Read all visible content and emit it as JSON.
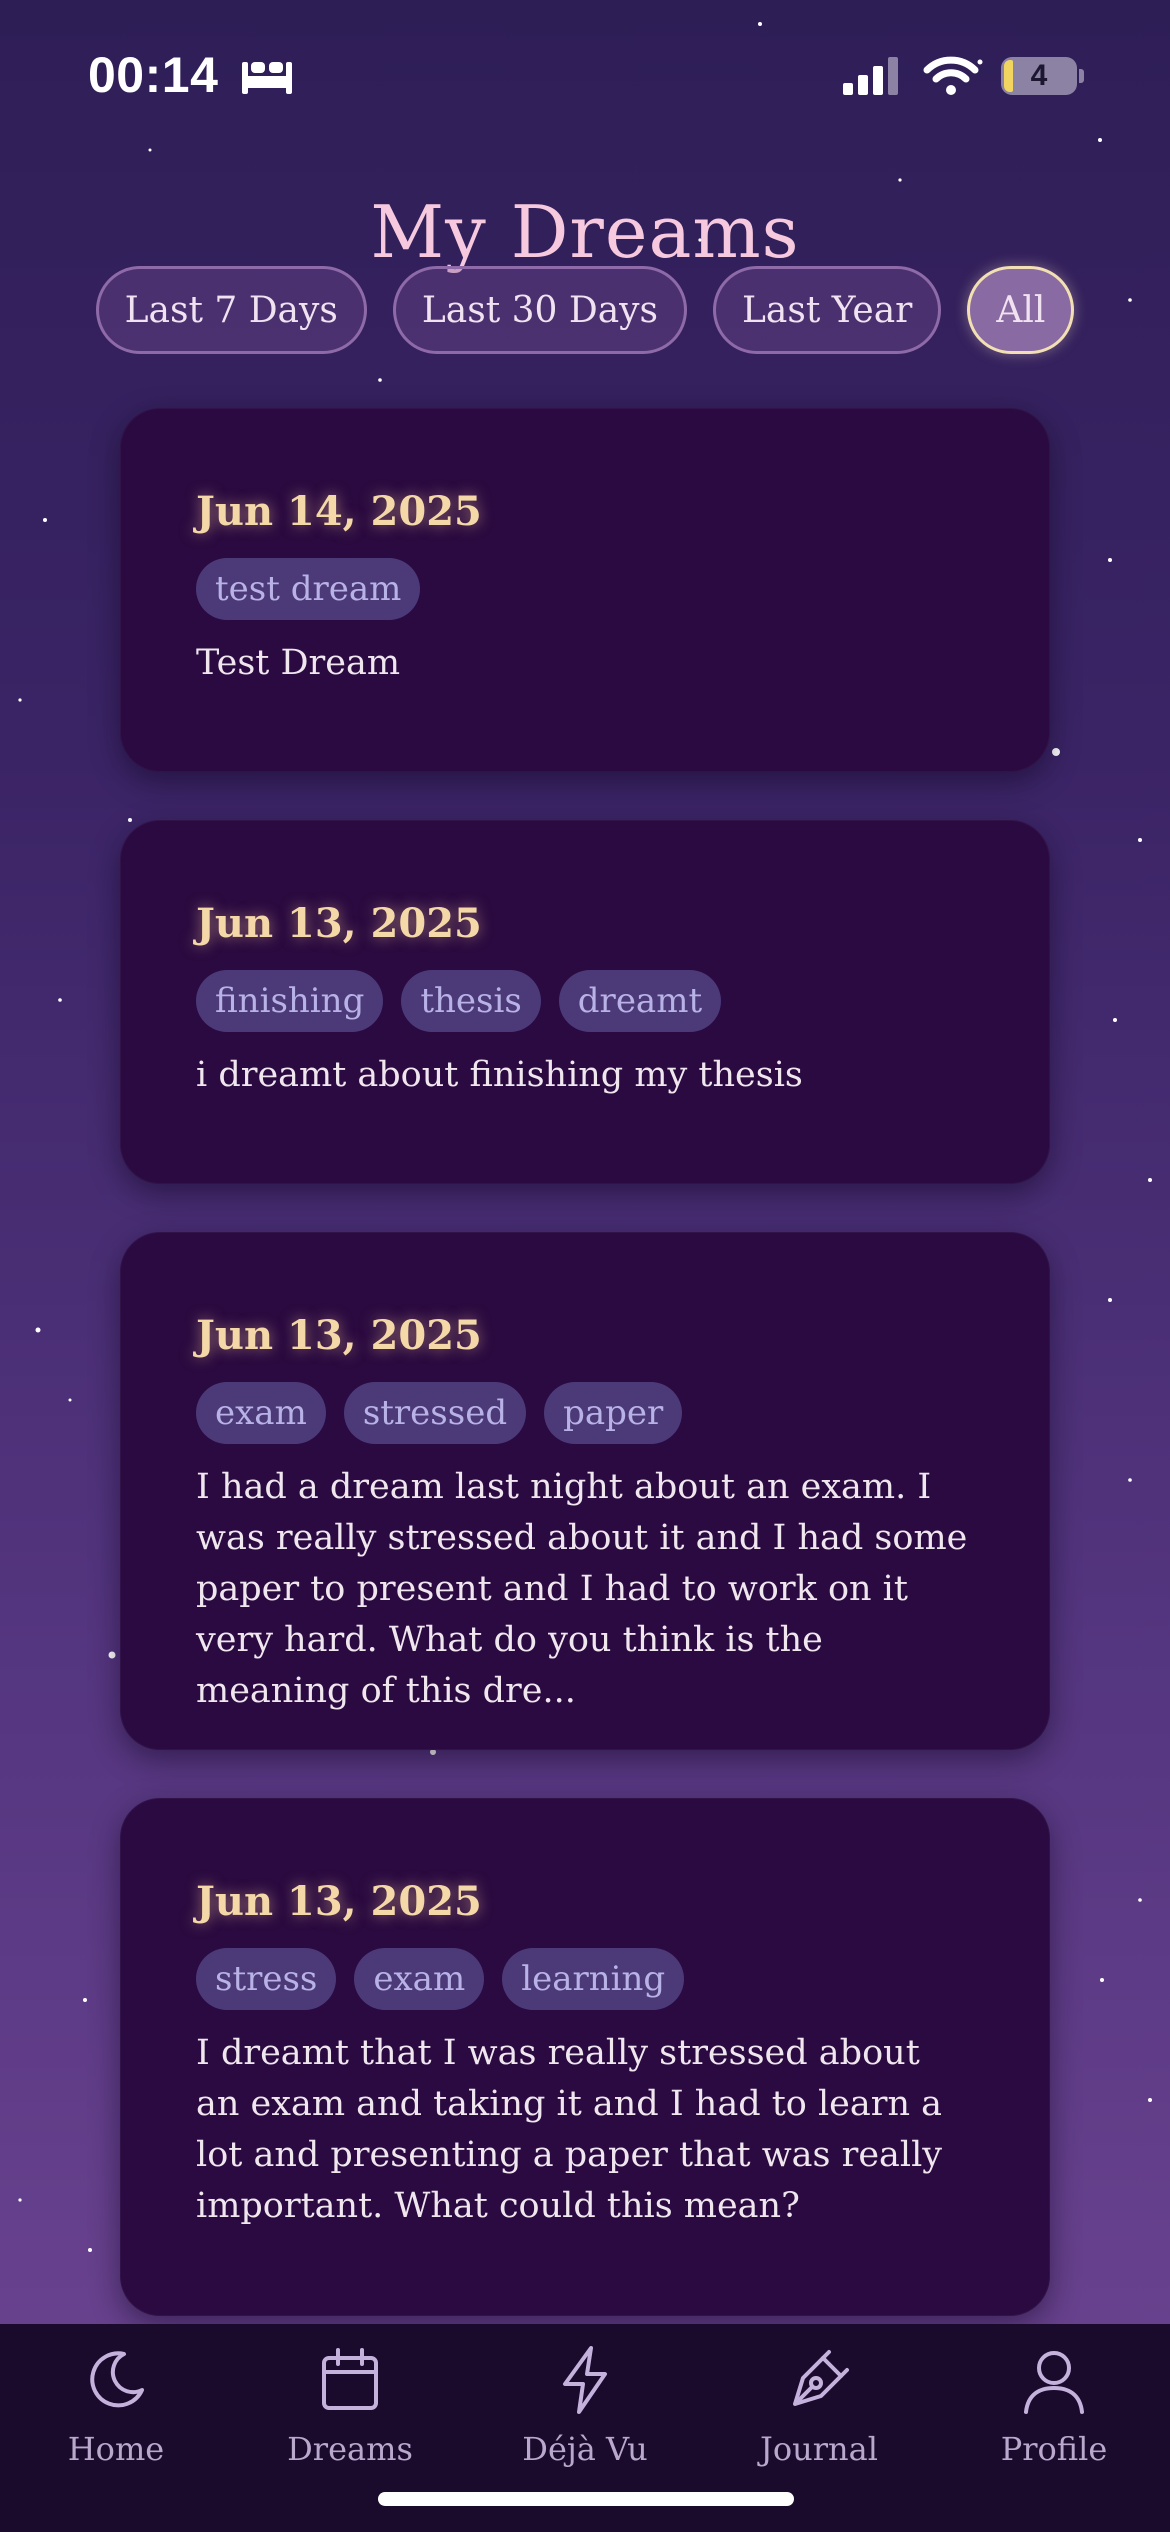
{
  "status_bar": {
    "time": "00:14",
    "battery": "4",
    "icons": [
      "bed-icon",
      "cellular-signal-icon",
      "wifi-icon",
      "battery-icon"
    ]
  },
  "page": {
    "title": "My Dreams"
  },
  "filters": [
    {
      "label": "Last 7 Days",
      "active": false
    },
    {
      "label": "Last 30 Days",
      "active": false
    },
    {
      "label": "Last Year",
      "active": false
    },
    {
      "label": "All",
      "active": true
    }
  ],
  "dreams": [
    {
      "date": "Jun 14, 2025",
      "tags": [
        "test dream"
      ],
      "text": "Test Dream"
    },
    {
      "date": "Jun 13, 2025",
      "tags": [
        "finishing",
        "thesis",
        "dreamt"
      ],
      "text": "i dreamt about finishing my thesis"
    },
    {
      "date": "Jun 13, 2025",
      "tags": [
        "exam",
        "stressed",
        "paper"
      ],
      "text": "I had a dream last night about an exam. I was really stressed about it and I had some paper to present and I had to work on it very hard. What do you think is the meaning of this dre..."
    },
    {
      "date": "Jun 13, 2025",
      "tags": [
        "stress",
        "exam",
        "learning"
      ],
      "text": "I dreamt that I was really stressed about an exam and taking it and I had to learn a lot and presenting a paper that was really important. What could this mean?"
    }
  ],
  "nav": [
    {
      "label": "Home",
      "icon": "moon-icon"
    },
    {
      "label": "Dreams",
      "icon": "calendar-icon"
    },
    {
      "label": "Déjà Vu",
      "icon": "lightning-icon"
    },
    {
      "label": "Journal",
      "icon": "pen-nib-icon"
    },
    {
      "label": "Profile",
      "icon": "user-icon"
    }
  ],
  "colors": {
    "title": "#f6c9de",
    "card_bg": "#2a0a40",
    "date": "#f4d8a8",
    "tag_bg": "#4c3a78",
    "tag_text": "#b8b2e6",
    "nav_bg": "#1a0a2c",
    "nav_text": "#b9a8cc",
    "active_chip_border": "#f2e0b4"
  }
}
